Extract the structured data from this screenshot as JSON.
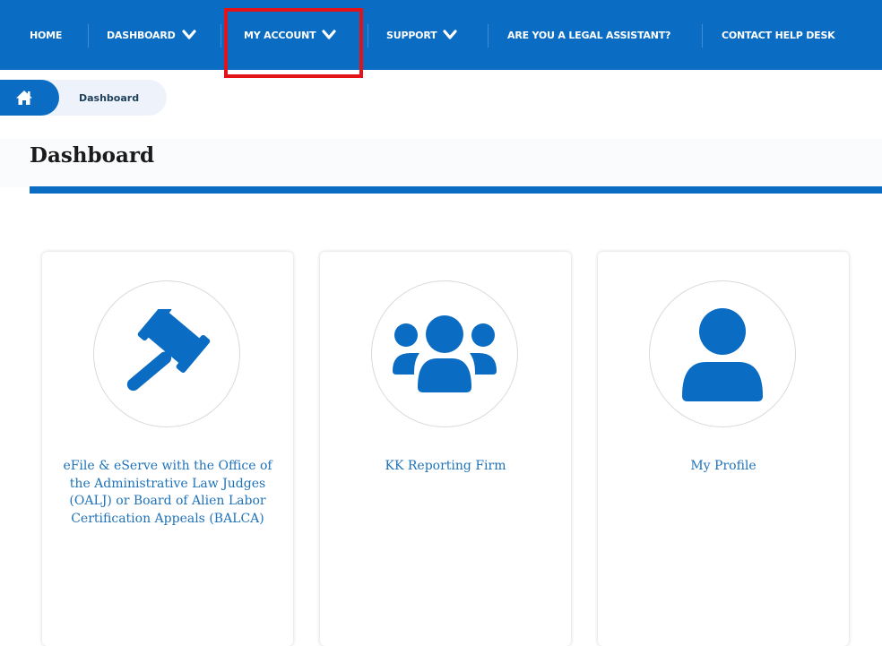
{
  "nav": {
    "items": [
      {
        "label": "HOME",
        "dropdown": false
      },
      {
        "label": "DASHBOARD",
        "dropdown": true
      },
      {
        "label": "MY ACCOUNT",
        "dropdown": true
      },
      {
        "label": "SUPPORT",
        "dropdown": true
      },
      {
        "label": "ARE YOU A LEGAL ASSISTANT?",
        "dropdown": false
      },
      {
        "label": "CONTACT HELP DESK",
        "dropdown": false
      }
    ],
    "highlighted_item": "MY ACCOUNT"
  },
  "breadcrumb": {
    "home_icon": "home-icon",
    "current": "Dashboard"
  },
  "page": {
    "title": "Dashboard"
  },
  "cards": [
    {
      "icon": "gavel-icon",
      "label": "eFile & eServe with the Office of the Administrative Law Judges (OALJ) or Board of Alien Labor Certification Appeals (BALCA)"
    },
    {
      "icon": "users-icon",
      "label": "KK Reporting Firm"
    },
    {
      "icon": "user-icon",
      "label": "My Profile"
    }
  ],
  "colors": {
    "nav_bg": "#0a6cc2",
    "accent": "#0a6cc2",
    "link": "#1f72b8",
    "highlight_border": "#e3131a"
  }
}
